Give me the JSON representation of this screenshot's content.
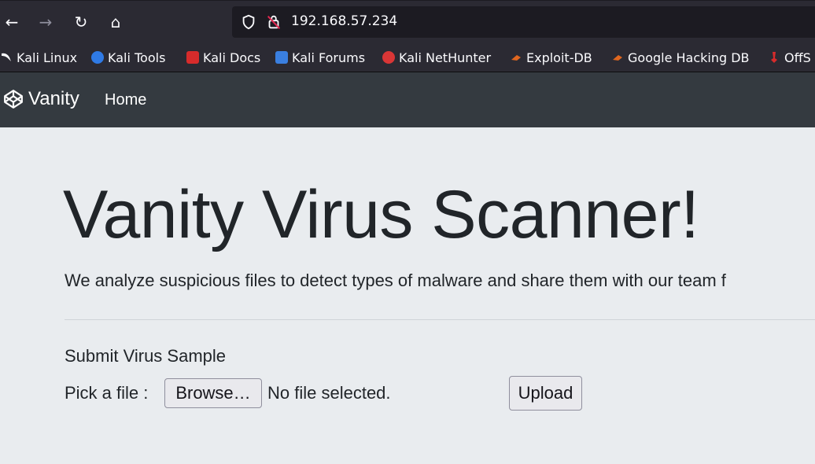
{
  "browser": {
    "back_icon": "←",
    "forward_icon": "→",
    "reload_icon": "↻",
    "home_icon": "⌂",
    "url": "192.168.57.234",
    "icons": [
      "arrow-left-icon",
      "arrow-right-icon",
      "reload-icon",
      "home-icon",
      "shield-icon",
      "insecure-lock-icon"
    ]
  },
  "bookmarks": [
    {
      "label": "Kali Linux",
      "icon": "kali-dragon-icon",
      "color": "#367bf0"
    },
    {
      "label": "Kali Tools",
      "icon": "kali-tools-icon",
      "color": "#2f7ae5"
    },
    {
      "label": "Kali Docs",
      "icon": "kali-docs-icon",
      "color": "#d72b2b"
    },
    {
      "label": "Kali Forums",
      "icon": "kali-forums-icon",
      "color": "#3a7fe0"
    },
    {
      "label": "Kali NetHunter",
      "icon": "nethunter-icon",
      "color": "#d93636"
    },
    {
      "label": "Exploit-DB",
      "icon": "exploit-db-icon",
      "color": "#e0661f"
    },
    {
      "label": "Google Hacking DB",
      "icon": "ghdb-icon",
      "color": "#e0661f"
    },
    {
      "label": "OffS",
      "icon": "offsec-icon",
      "color": "#d72b2b"
    }
  ],
  "navbar": {
    "brand": "Vanity",
    "brand_icon": "codepen-cube-icon",
    "home_link": "Home"
  },
  "main": {
    "title": "Vanity Virus Scanner!",
    "lead": "We analyze suspicious files to detect types of malware and share them with our team f",
    "form_title": "Submit Virus Sample",
    "pick_label": "Pick a file :",
    "browse_label": "Browse…",
    "file_status": "No file selected.",
    "upload_label": "Upload"
  },
  "colors": {
    "browser_chrome": "#2b2a33",
    "navbar": "#343a40",
    "page_bg": "#e9ecef",
    "text": "#212529"
  }
}
